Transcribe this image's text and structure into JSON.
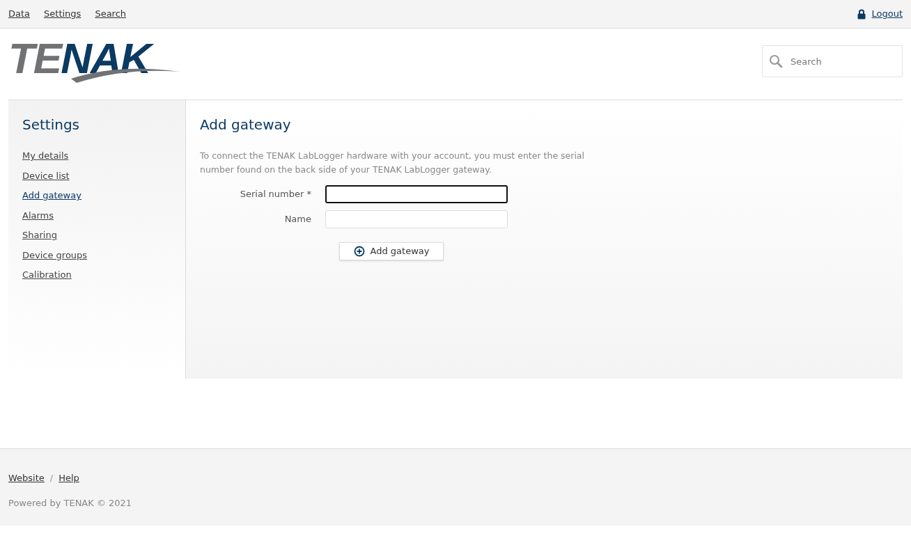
{
  "top_nav": {
    "links": [
      "Data",
      "Settings",
      "Search"
    ],
    "logout": "Logout"
  },
  "logo": {
    "text": "TENAK"
  },
  "search": {
    "placeholder": "Search"
  },
  "sidebar": {
    "title": "Settings",
    "items": [
      {
        "label": "My details",
        "selected": false
      },
      {
        "label": "Device list",
        "selected": false
      },
      {
        "label": "Add gateway",
        "selected": true
      },
      {
        "label": "Alarms",
        "selected": false
      },
      {
        "label": "Sharing",
        "selected": false
      },
      {
        "label": "Device groups",
        "selected": false
      },
      {
        "label": "Calibration",
        "selected": false
      }
    ]
  },
  "main": {
    "title": "Add gateway",
    "description": "To connect the TENAK LabLogger hardware with your account, you must enter the serial number found on the back side of your TENAK LabLogger gateway.",
    "fields": [
      {
        "label": "Serial number *",
        "focused": true
      },
      {
        "label": "Name",
        "focused": false
      }
    ],
    "submit": "Add gateway"
  },
  "footer": {
    "links": [
      "Website",
      "Help"
    ],
    "separator": "/",
    "copyright": "Powered by TENAK © 2021"
  }
}
